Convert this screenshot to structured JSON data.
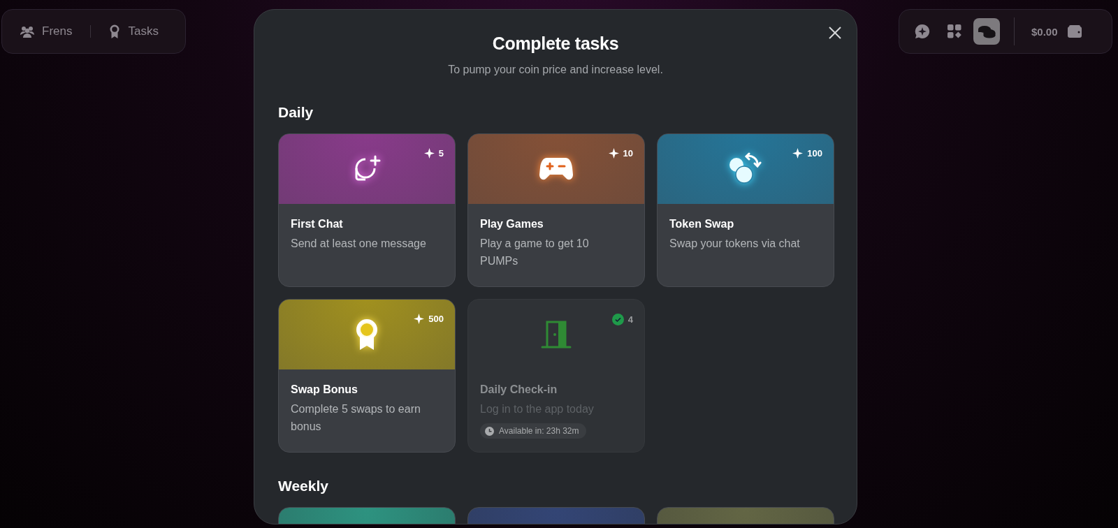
{
  "nav_left": {
    "items": [
      {
        "label": "Frens"
      },
      {
        "label": "Tasks"
      }
    ]
  },
  "nav_right": {
    "buttons": [
      {
        "selected": false
      },
      {
        "selected": false
      },
      {
        "selected": true
      }
    ],
    "balance": "$0.00"
  },
  "modal": {
    "title": "Complete tasks",
    "subtitle": "To pump your coin price and increase level.",
    "sections": [
      {
        "title": "Daily",
        "tasks": [
          {
            "title": "First Chat",
            "description": "Send at least one message",
            "reward": "5",
            "color": "#8e3a8f",
            "completed": false
          },
          {
            "title": "Play Games",
            "description": "Play a game to get 10 PUMPs",
            "reward": "10",
            "color": "#8a5236",
            "completed": false
          },
          {
            "title": "Token Swap",
            "description": "Swap your tokens via chat",
            "reward": "100",
            "color": "#23799e",
            "completed": false
          },
          {
            "title": "Swap Bonus",
            "description": "Complete 5 swaps to earn bonus",
            "reward": "500",
            "color": "#a8961c",
            "completed": false
          },
          {
            "title": "Daily Check-in",
            "description": "Log in to the app today",
            "reward": "4",
            "completed": true,
            "availability": "Available in: 23h 32m"
          }
        ]
      },
      {
        "title": "Weekly",
        "tasks": [
          {
            "color": "#2e9a86",
            "completed": false
          },
          {
            "color": "#34477a",
            "completed": false
          },
          {
            "color": "#676a46",
            "completed": false
          }
        ]
      }
    ]
  }
}
